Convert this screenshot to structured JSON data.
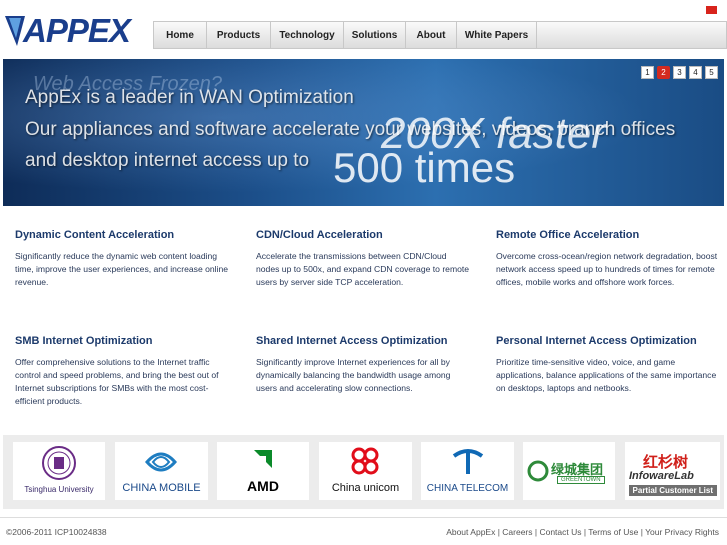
{
  "header": {
    "logo_text": "APPEX",
    "nav": [
      "Home",
      "Products",
      "Technology",
      "Solutions",
      "About",
      "White Papers"
    ]
  },
  "banner": {
    "ghost_text_1": "Web Access Frozen?",
    "ghost_text_2": "200X faster",
    "ghost_text_3": "500 times",
    "line1": "AppEx is a leader in WAN Optimization",
    "line2": "Our appliances and software accelerate your websites, videos, branch offices",
    "line3": "and desktop internet access up to",
    "pager": [
      "1",
      "2",
      "3",
      "4",
      "5"
    ],
    "pager_active": 1
  },
  "features": [
    {
      "title": "Dynamic Content Acceleration",
      "text": "Significantly reduce the dynamic web content loading time, improve the user experiences, and increase online revenue."
    },
    {
      "title": "CDN/Cloud Acceleration",
      "text": "Accelerate the transmissions between CDN/Cloud nodes up to 500x, and expand CDN coverage to remote users by server side TCP acceleration."
    },
    {
      "title": "Remote Office Acceleration",
      "text": "Overcome cross-ocean/region network degradation, boost network access speed up to hundreds of times for remote offices, mobile works and offshore work forces."
    },
    {
      "title": "SMB Internet Optimization",
      "text": "Offer comprehensive solutions to the Internet traffic control and speed problems, and bring the best out of Internet subscriptions for SMBs with the most cost-efficient products."
    },
    {
      "title": "Shared Internet Access Optimization",
      "text": "Significantly improve Internet experiences for all by dynamically balancing the bandwidth usage among users and accelerating slow connections."
    },
    {
      "title": "Personal Internet Access Optimization",
      "text": "Prioritize time-sensitive video, voice, and game applications, balance applications of the same importance on desktops, laptops and netbooks."
    }
  ],
  "partners": {
    "items": [
      "Tsinghua University",
      "CHINA MOBILE",
      "AMD",
      "China unicom",
      "CHINA TELECOM",
      "绿城集团",
      "红杉树"
    ],
    "greentown_sub": "GREENTOWN",
    "infoware": "InfowareLab",
    "partial_label": "Partial Customer List"
  },
  "footer": {
    "copyright": "©2006-2011 ICP10024838",
    "links": [
      "About AppEx",
      "Careers",
      "Contact Us",
      "Terms of Use",
      "Your Privacy Rights"
    ]
  },
  "colors": {
    "brand": "#1a3e8c",
    "accent": "#d32a1f",
    "heading": "#1c3a6b"
  }
}
